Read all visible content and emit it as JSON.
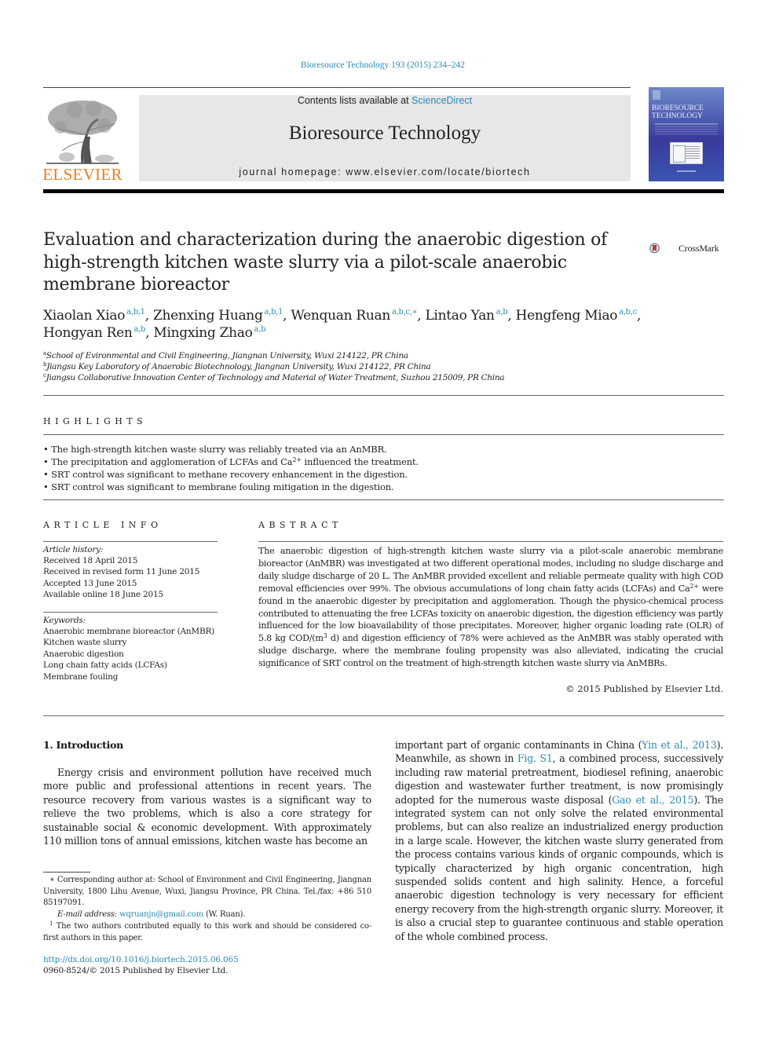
{
  "header": {
    "citation": "Bioresource Technology 193 (2015) 234–242",
    "contents_prefix": "Contents lists available at ",
    "contents_link": "ScienceDirect",
    "journal_name": "Bioresource Technology",
    "homepage": "journal homepage: www.elsevier.com/locate/biortech",
    "publisher_logo_text": "ELSEVIER",
    "cover_title_line1": "BIORESOURCE",
    "cover_title_line2": "TECHNOLOGY",
    "crossmark_label": "CrossMark",
    "colors": {
      "link": "#2a8bb5",
      "elsevier_orange": "#f07d1e",
      "journal_box": "#e7e7e7"
    }
  },
  "article": {
    "title": "Evaluation and characterization during the anaerobic digestion of high-strength kitchen waste slurry via a pilot-scale anaerobic membrane bioreactor",
    "authors": [
      {
        "name": "Xiaolan Xiao",
        "sup": "a,b,1",
        "sep": ", "
      },
      {
        "name": "Zhenxing Huang",
        "sup": "a,b,1",
        "sep": ", "
      },
      {
        "name": "Wenquan Ruan",
        "sup": "a,b,c,∗",
        "sep": ", "
      },
      {
        "name": "Lintao Yan",
        "sup": "a,b",
        "sep": ", "
      },
      {
        "name": "Hengfeng Miao",
        "sup": "a,b,c",
        "sep": ","
      },
      {
        "name": "Hongyan Ren",
        "sup": "a,b",
        "sep": ", "
      },
      {
        "name": "Mingxing Zhao",
        "sup": "a,b",
        "sep": ""
      }
    ],
    "affiliations": [
      {
        "key": "a",
        "text": "School of Evironmental and Civil Engineering, Jiangnan University, Wuxi 214122, PR China"
      },
      {
        "key": "b",
        "text": "Jiangsu Key Laboratory of Anaerobic Biotechnology, Jiangnan University, Wuxi 214122, PR China"
      },
      {
        "key": "c",
        "text": "Jiangsu Collaborative Innovation Center of Technology and Material of Water Treatment, Suzhou 215009, PR China"
      }
    ]
  },
  "highlights": {
    "heading": "HIGHLIGHTS",
    "items": [
      "The high-strength kitchen waste slurry was reliably treated via an AnMBR.",
      "The precipitation and agglomeration of LCFAs and Ca",
      "SRT control was significant to methane recovery enhancement in the digestion.",
      "SRT control was significant to membrane fouling mitigation in the digestion."
    ],
    "item2_sup": "2+",
    "item2_suffix": " influenced the treatment."
  },
  "article_info": {
    "heading": "ARTICLE INFO",
    "history_label": "Article history:",
    "history": [
      "Received 18 April 2015",
      "Received in revised form 11 June 2015",
      "Accepted 13 June 2015",
      "Available online 18 June 2015"
    ],
    "keywords_label": "Keywords:",
    "keywords": [
      "Anaerobic membrane bioreactor (AnMBR)",
      "Kitchen waste slurry",
      "Anaerobic digestion",
      "Long chain fatty acids (LCFAs)",
      "Membrane fouling"
    ]
  },
  "abstract": {
    "heading": "ABSTRACT",
    "part1": "The anaerobic digestion of high-strength kitchen waste slurry via a pilot-scale anaerobic membrane bioreactor (AnMBR) was investigated at two different operational modes, including no sludge discharge and daily sludge discharge of 20 L. The AnMBR provided excellent and reliable permeate quality with high COD removal efficiencies over 99%. The obvious accumulations of long chain fatty acids (LCFAs) and Ca",
    "sup1": "2+",
    "part2": " were found in the anaerobic digester by precipitation and agglomeration. Though the physico-chemical process contributed to attenuating the free LCFAs toxicity on anaerobic digestion, the digestion efficiency was partly influenced for the low bioavailability of those precipitates. Moreover, higher organic loading rate (OLR) of 5.8 kg COD/(m",
    "sup2": "3",
    "part3": " d) and digestion efficiency of 78% were achieved as the AnMBR was stably operated with sludge discharge, where the membrane fouling propensity was also alleviated, indicating the crucial significance of SRT control on the treatment of high-strength kitchen waste slurry via AnMBRs.",
    "copyright": "© 2015 Published by Elsevier Ltd."
  },
  "introduction": {
    "heading": "1. Introduction",
    "left_para": "Energy crisis and environment pollution have received much more public and professional attentions in recent years. The resource recovery from various wastes is a significant way to relieve the two problems, which is also a core strategy for sustainable social & economic development. With approximately 110 million tons of annual emissions, kitchen waste has become an",
    "right_p1": "important part of organic contaminants in China (",
    "ref1": "Yin et al., 2013",
    "right_p2": "). Meanwhile, as shown in ",
    "ref2": "Fig. S1",
    "right_p3": ", a combined process, successively including raw material pretreatment, biodiesel refining, anaerobic digestion and wastewater further treatment, is now promisingly adopted for the numerous waste disposal (",
    "ref3": "Gao et al., 2015",
    "right_p4": "). The integrated system can not only solve the related environmental problems, but can also realize an industrialized energy production in a large scale. However, the kitchen waste slurry generated from the process contains various kinds of organic compounds, which is typically characterized by high organic concentration, high suspended solids content and high salinity. Hence, a forceful anaerobic digestion technology is very necessary for efficient energy recovery from the high-strength organic slurry. Moreover, it is also a crucial step to guarantee continuous and stable operation of the whole combined process."
  },
  "footnotes": {
    "corresponding": "∗ Corresponding author at: School of Environment and Civil Engineering, Jiangnan University, 1800 Lihu Avenue, Wuxi, Jiangsu Province, PR China. Tel./fax: +86 510 85197091.",
    "email_label": "E-mail address: ",
    "email": "wqruanjn@gmail.com",
    "email_suffix": " (W. Ruan).",
    "equal_sup": "1",
    "equal": " The two authors contributed equally to this work and should be considered co-first authors in this paper.",
    "doi": "http://dx.doi.org/10.1016/j.biortech.2015.06.065",
    "issn": "0960-8524/© 2015 Published by Elsevier Ltd."
  }
}
